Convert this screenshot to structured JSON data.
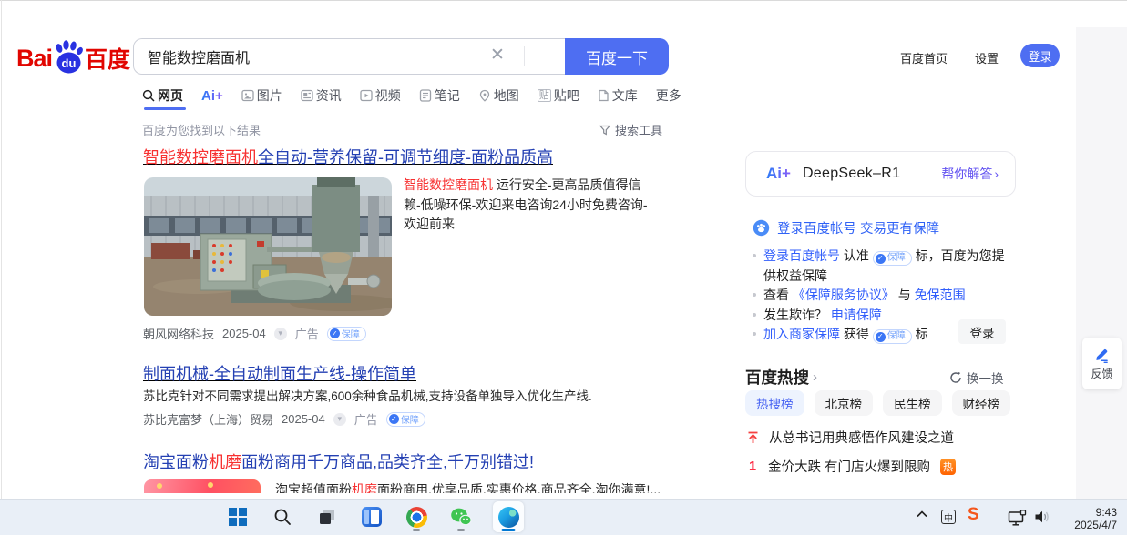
{
  "colors": {
    "accent": "#4e6ef2",
    "title_blue": "#2440b3",
    "highlight_red": "#f73131",
    "sidebar_link_blue": "#315efb",
    "hot_badge_orange": "#ff6300",
    "baidu_logo_red": "#e10601"
  },
  "header": {
    "logo": {
      "bai": "Bai",
      "du": "du",
      "cn": "百度"
    },
    "search": {
      "value": "智能数控磨面机",
      "clear_icon": "✕",
      "button": "百度一下"
    },
    "links": {
      "home": "百度首页",
      "settings": "设置",
      "login": "登录"
    }
  },
  "nav": {
    "tabs": [
      {
        "label": "网页"
      },
      {
        "label": "Ai+"
      },
      {
        "label": "图片"
      },
      {
        "label": "资讯"
      },
      {
        "label": "视频"
      },
      {
        "label": "笔记"
      },
      {
        "label": "地图"
      },
      {
        "label": "贴吧"
      },
      {
        "label": "文库"
      },
      {
        "label": "更多"
      }
    ]
  },
  "meta": {
    "found": "百度为您找到以下结果",
    "tools": "搜索工具"
  },
  "results": {
    "r1": {
      "title_em": "智能数控磨面机",
      "title_rest": "全自动-营养保留-可调节细度-面粉品质高",
      "desc_em": "智能数控磨面机",
      "desc_rest": " 运行安全-更高品质值得信赖-低噪环保-欢迎来电咨询24小时免费咨询-欢迎前来",
      "source": "朝风网络科技",
      "date": "2025-04",
      "ad": "广告",
      "badge": "保障"
    },
    "r2": {
      "title": "制面机械-全自动制面生产线-操作简单",
      "desc": "苏比克针对不同需求提出解决方案,600余种食品机械,支持设备单独导入优化生产线.",
      "source": "苏比克富梦（上海）贸易",
      "date": "2025-04",
      "ad": "广告",
      "badge": "保障"
    },
    "r3": {
      "title_pre": "淘宝面粉",
      "title_em": "机磨",
      "title_rest": "面粉商用千万商品,品类齐全,千万别错过!",
      "partial_pre": "淘宝超值面粉",
      "partial_em": "机磨",
      "partial_rest": "面粉商用,优享品质,实惠价格,商品齐全,淘你满意!..."
    }
  },
  "sidebar": {
    "deepseek": {
      "logo": "Ai+",
      "name": "DeepSeek–R1",
      "cta": "帮你解答",
      "chevron": "›"
    },
    "protect": {
      "header": "登录百度帐号 交易更有保障",
      "i1_link": "登录百度帐号",
      "i1_mid": "认准",
      "i1_badge": "保障",
      "i1_tail": "标，百度为您提供权益保障",
      "i2_pre": "查看",
      "i2_link1": "《保障服务协议》",
      "i2_mid": "与",
      "i2_link2": "免保范围",
      "i3_pre": "发生欺诈？",
      "i3_link": "申请保障",
      "i4_link": "加入商家保障",
      "i4_mid": "获得",
      "i4_badge": "保障",
      "i4_tail": "标",
      "login_button": "登录"
    },
    "hot": {
      "title": "百度热搜",
      "chevron": "›",
      "refresh": "换一换",
      "tabs": [
        {
          "label": "热搜榜"
        },
        {
          "label": "北京榜"
        },
        {
          "label": "民生榜"
        },
        {
          "label": "财经榜"
        }
      ],
      "top_item": {
        "text": "从总书记用典感悟作风建设之道"
      },
      "item1": {
        "rank": "1",
        "text": "金价大跌 有门店火爆到限购",
        "badge": "热"
      }
    }
  },
  "feedback": {
    "label": "反馈"
  },
  "taskbar": {
    "time": "9:43",
    "date": "2025/4/7"
  }
}
